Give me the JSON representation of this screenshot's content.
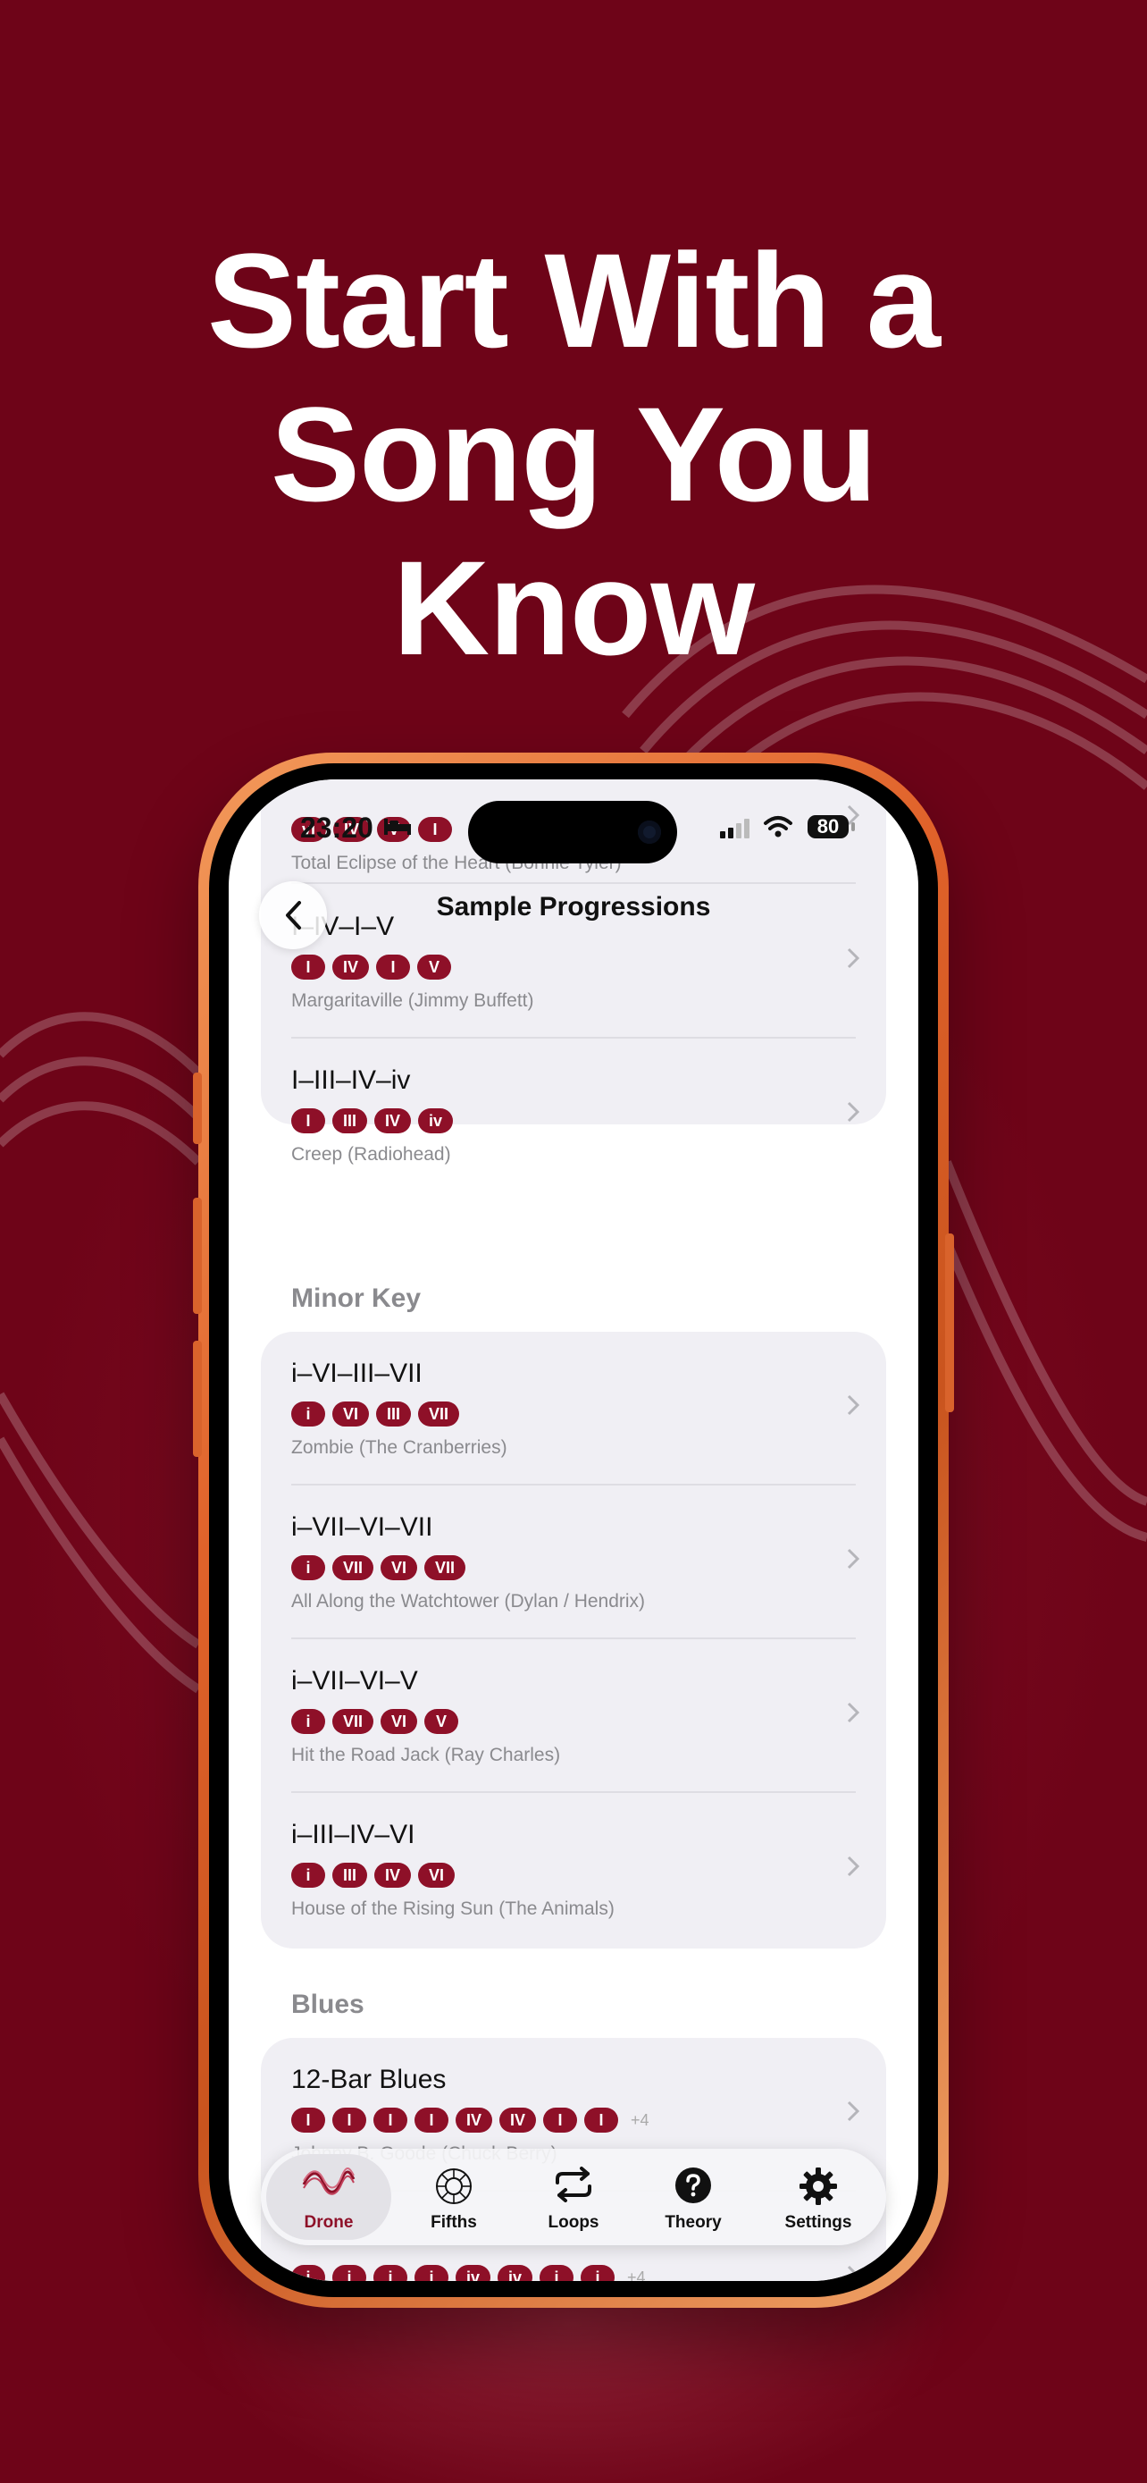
{
  "headline": {
    "line1": "Start With a",
    "line2": "Song You",
    "line3": "Know"
  },
  "status": {
    "time": "23:20",
    "battery": "80"
  },
  "nav": {
    "title": "Sample Progressions"
  },
  "partial_top": {
    "chips": [
      "vi",
      "IV",
      "V",
      "I"
    ],
    "subtitle": "Total Eclipse of the Heart (Bonnie Tyler)"
  },
  "major_rows": [
    {
      "title": "I–IV–I–V",
      "chips": [
        "I",
        "IV",
        "I",
        "V"
      ],
      "subtitle": "Margaritaville (Jimmy Buffett)"
    },
    {
      "title": "I–III–IV–iv",
      "chips": [
        "I",
        "III",
        "IV",
        "iv"
      ],
      "subtitle": "Creep (Radiohead)"
    }
  ],
  "minor_section": {
    "header": "Minor Key"
  },
  "minor_rows": [
    {
      "title": "i–VI–III–VII",
      "chips": [
        "i",
        "VI",
        "III",
        "VII"
      ],
      "subtitle": "Zombie (The Cranberries)"
    },
    {
      "title": "i–VII–VI–VII",
      "chips": [
        "i",
        "VII",
        "VI",
        "VII"
      ],
      "subtitle": "All Along the Watchtower (Dylan / Hendrix)"
    },
    {
      "title": "i–VII–VI–V",
      "chips": [
        "i",
        "VII",
        "VI",
        "V"
      ],
      "subtitle": "Hit the Road Jack (Ray Charles)"
    },
    {
      "title": "i–III–IV–VI",
      "chips": [
        "i",
        "III",
        "IV",
        "VI"
      ],
      "subtitle": "House of the Rising Sun (The Animals)"
    }
  ],
  "blues_section": {
    "header": "Blues"
  },
  "blues_rows": [
    {
      "title": "12-Bar Blues",
      "chips": [
        "I",
        "I",
        "I",
        "I",
        "IV",
        "IV",
        "I",
        "I"
      ],
      "more": "+4",
      "subtitle": "Johnny B. Goode (Chuck Berry)"
    },
    {
      "title": "",
      "chips": [
        "i",
        "i",
        "i",
        "i",
        "iv",
        "iv",
        "i",
        "i"
      ],
      "more": "+4",
      "subtitle": ""
    }
  ],
  "tabs": [
    {
      "label": "Drone",
      "icon": "drone-wave-icon"
    },
    {
      "label": "Fifths",
      "icon": "circle-of-fifths-icon"
    },
    {
      "label": "Loops",
      "icon": "repeat-icon"
    },
    {
      "label": "Theory",
      "icon": "question-circle-icon"
    },
    {
      "label": "Settings",
      "icon": "gear-icon"
    }
  ],
  "colors": {
    "background": "#6e0418",
    "accent": "#8e1028",
    "phone_frame": "#e0622a"
  }
}
